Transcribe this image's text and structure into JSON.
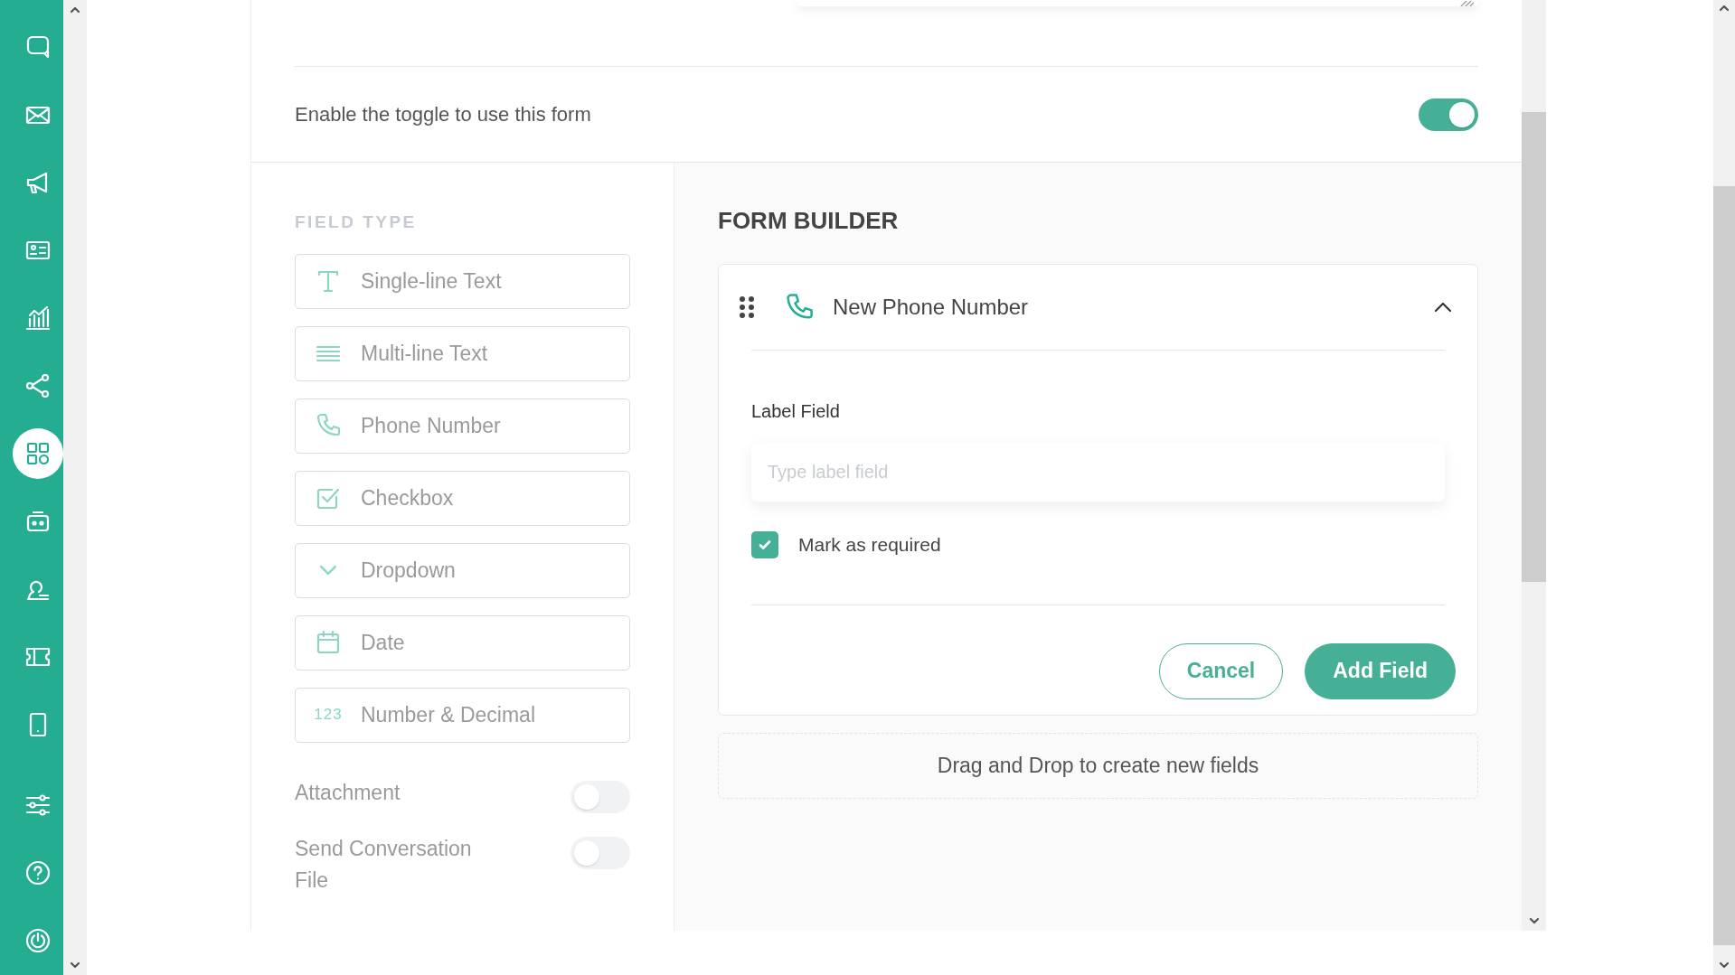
{
  "sidebar": {
    "items": [
      {
        "selected": false
      },
      {
        "selected": false
      },
      {
        "selected": false
      },
      {
        "selected": false
      },
      {
        "selected": false
      },
      {
        "selected": false
      },
      {
        "selected": true
      },
      {
        "selected": false
      },
      {
        "selected": false
      },
      {
        "selected": false
      },
      {
        "selected": false
      },
      {
        "selected": false
      },
      {
        "selected": false
      },
      {
        "selected": false
      }
    ]
  },
  "form_toggle": {
    "label": "Enable the toggle to use this form",
    "on": true
  },
  "field_type": {
    "title": "FIELD TYPE",
    "items": [
      {
        "kind": "text",
        "label": "Single-line Text"
      },
      {
        "kind": "multiline",
        "label": "Multi-line Text"
      },
      {
        "kind": "phone",
        "label": "Phone Number"
      },
      {
        "kind": "checkbox",
        "label": "Checkbox"
      },
      {
        "kind": "dropdown",
        "label": "Dropdown"
      },
      {
        "kind": "date",
        "label": "Date"
      },
      {
        "kind": "number",
        "icon_text": "123",
        "label": "Number & Decimal"
      }
    ],
    "options": [
      {
        "label": "Attachment",
        "on": false
      },
      {
        "label": "Send Conversation File",
        "on": false
      }
    ]
  },
  "form_builder": {
    "title": "FORM BUILDER",
    "field": {
      "kind": "phone",
      "title": "New Phone Number",
      "expanded": true,
      "label": "Label Field",
      "placeholder": "Type label field",
      "required": {
        "label": "Mark as required",
        "checked": true
      },
      "buttons": [
        {
          "kind": "outline",
          "label": "Cancel"
        },
        {
          "kind": "primary",
          "label": "Add Field"
        }
      ]
    },
    "drop_hint": "Drag and Drop to create new fields"
  }
}
